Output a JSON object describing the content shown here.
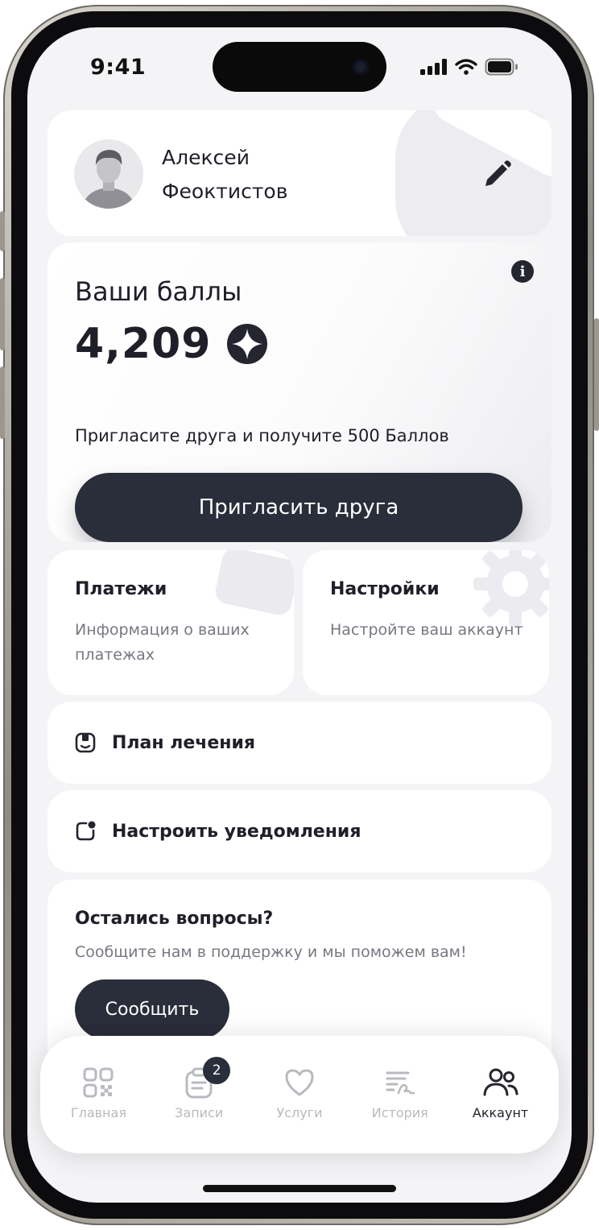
{
  "status_bar": {
    "time": "9:41"
  },
  "profile": {
    "first_name": "Алексей",
    "last_name": "Феоктистов"
  },
  "points": {
    "title": "Ваши баллы",
    "value": "4,209",
    "invite_text": "Пригласите друга и получите 500 Баллов",
    "invite_button": "Пригласить друга"
  },
  "cards": {
    "payments": {
      "title": "Платежи",
      "subtitle": "Информация о ваших платежах"
    },
    "settings": {
      "title": "Настройки",
      "subtitle": "Настройте ваш аккаунт"
    }
  },
  "rows": {
    "treatment_plan": "План лечения",
    "notifications": "Настроить уведомления"
  },
  "support": {
    "title": "Остались вопросы?",
    "subtitle": "Сообщите нам в поддержку и мы поможем вам!",
    "button": "Сообщить"
  },
  "tabbar": {
    "items": [
      {
        "label": "Главная",
        "icon": "grid-icon"
      },
      {
        "label": "Записи",
        "icon": "clipboard-icon",
        "badge": "2"
      },
      {
        "label": "Услуги",
        "icon": "heart-icon"
      },
      {
        "label": "История",
        "icon": "history-icon"
      },
      {
        "label": "Аккаунт",
        "icon": "users-icon",
        "active": true
      }
    ]
  },
  "colors": {
    "accent_dark": "#2a2d3a",
    "background": "#f4f4f6",
    "muted_text": "#777882",
    "inactive_tab": "#b9bac0"
  }
}
